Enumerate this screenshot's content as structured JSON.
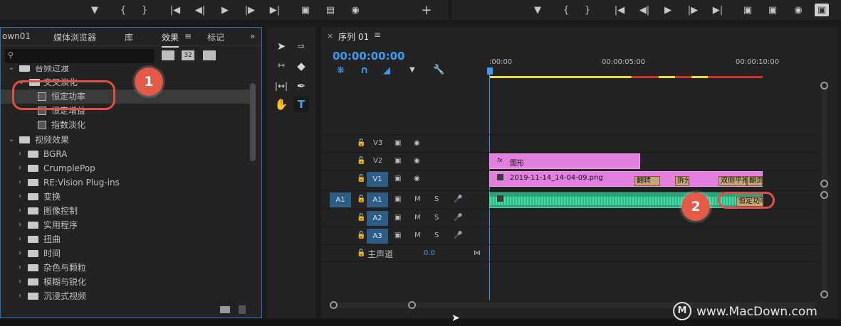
{
  "effects_panel": {
    "tabs": [
      "own01",
      "媒体浏览器",
      "库",
      "效果",
      "标记"
    ],
    "active_tab": "效果",
    "tree": [
      {
        "label": "音频过渡",
        "type": "folder",
        "indent": 0,
        "expanded": true
      },
      {
        "label": "交叉淡化",
        "type": "folder",
        "indent": 1,
        "expanded": true
      },
      {
        "label": "恒定功率",
        "type": "effect",
        "indent": 2,
        "selected": true
      },
      {
        "label": "恒定增益",
        "type": "effect",
        "indent": 2
      },
      {
        "label": "指数淡化",
        "type": "effect",
        "indent": 2
      },
      {
        "label": "视频效果",
        "type": "folder",
        "indent": 0,
        "expanded": true
      },
      {
        "label": "BGRA",
        "type": "folder",
        "indent": 1
      },
      {
        "label": "CrumplePop",
        "type": "folder",
        "indent": 1
      },
      {
        "label": "RE:Vision Plug-ins",
        "type": "folder",
        "indent": 1
      },
      {
        "label": "变换",
        "type": "folder",
        "indent": 1
      },
      {
        "label": "图像控制",
        "type": "folder",
        "indent": 1
      },
      {
        "label": "实用程序",
        "type": "folder",
        "indent": 1
      },
      {
        "label": "扭曲",
        "type": "folder",
        "indent": 1
      },
      {
        "label": "时间",
        "type": "folder",
        "indent": 1
      },
      {
        "label": "杂色与颗粒",
        "type": "folder",
        "indent": 1
      },
      {
        "label": "模糊与锐化",
        "type": "folder",
        "indent": 1
      },
      {
        "label": "沉浸式视频",
        "type": "folder",
        "indent": 1
      }
    ],
    "preset_icons": [
      "32"
    ]
  },
  "sequence": {
    "title": "序列 01",
    "timecode": "00:00:00:00",
    "ruler_labels": [
      ":00:00",
      "00:00:05:00",
      "00:00:10:00"
    ],
    "tracks": [
      {
        "name": "V3",
        "kind": "video"
      },
      {
        "name": "V2",
        "kind": "video"
      },
      {
        "name": "V1",
        "kind": "video",
        "targeted": true
      },
      {
        "name": "A1",
        "kind": "audio",
        "targeted": true,
        "source": "A1"
      },
      {
        "name": "A2",
        "kind": "audio",
        "targeted": true
      },
      {
        "name": "A3",
        "kind": "audio",
        "targeted": true
      }
    ],
    "audio_buttons": [
      "M",
      "S"
    ],
    "master": {
      "label": "主声道",
      "value": "0.0"
    },
    "clips": {
      "v2_label": "图形",
      "v1_label": "2019-11-14_14-04-09.png",
      "transitions_v1": [
        "翻转",
        "拆分",
        "双侧平推",
        "翻页"
      ],
      "audio_transition": "恒定功率"
    }
  },
  "annotations": {
    "badge_1": "1",
    "badge_2": "2"
  },
  "watermark": "www.MacDown.com",
  "colors": {
    "accent_blue": "#2d8ceb",
    "clip_pink": "#e37fe0",
    "audio_green": "#2fbf8a",
    "annotation_red": "#e05046"
  }
}
